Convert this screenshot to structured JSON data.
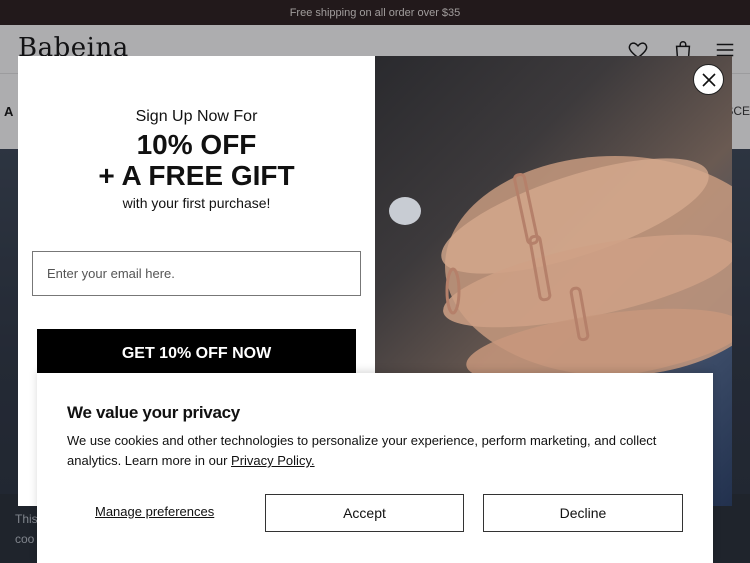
{
  "announcement": "Free shipping on all order over $35",
  "header": {
    "logo": "Babeina",
    "icons": [
      "heart-icon",
      "bag-icon",
      "menu-icon"
    ]
  },
  "nav": {
    "left_partial": "A",
    "right_partial": "SCE"
  },
  "background_cookie": {
    "line1": "This",
    "line2": "coo"
  },
  "signup_modal": {
    "subtitle": "Sign Up Now For",
    "headline_1": "10% OFF",
    "headline_2": "+ A FREE GIFT",
    "tagline": "with your first purchase!",
    "email_placeholder": "Enter your email here.",
    "cta_label": "GET 10% OFF NOW",
    "close_icon": "close-icon"
  },
  "privacy_banner": {
    "title": "We value your privacy",
    "body_text": "We use cookies and other technologies to personalize your experience, perform marketing, and collect analytics. Learn more in our ",
    "policy_link": "Privacy Policy.",
    "manage_label": "Manage preferences",
    "accept_label": "Accept",
    "decline_label": "Decline"
  },
  "colors": {
    "topbar_bg": "#2a1d1c",
    "cta_bg": "#000000",
    "hero_bg": "#2d3644"
  }
}
